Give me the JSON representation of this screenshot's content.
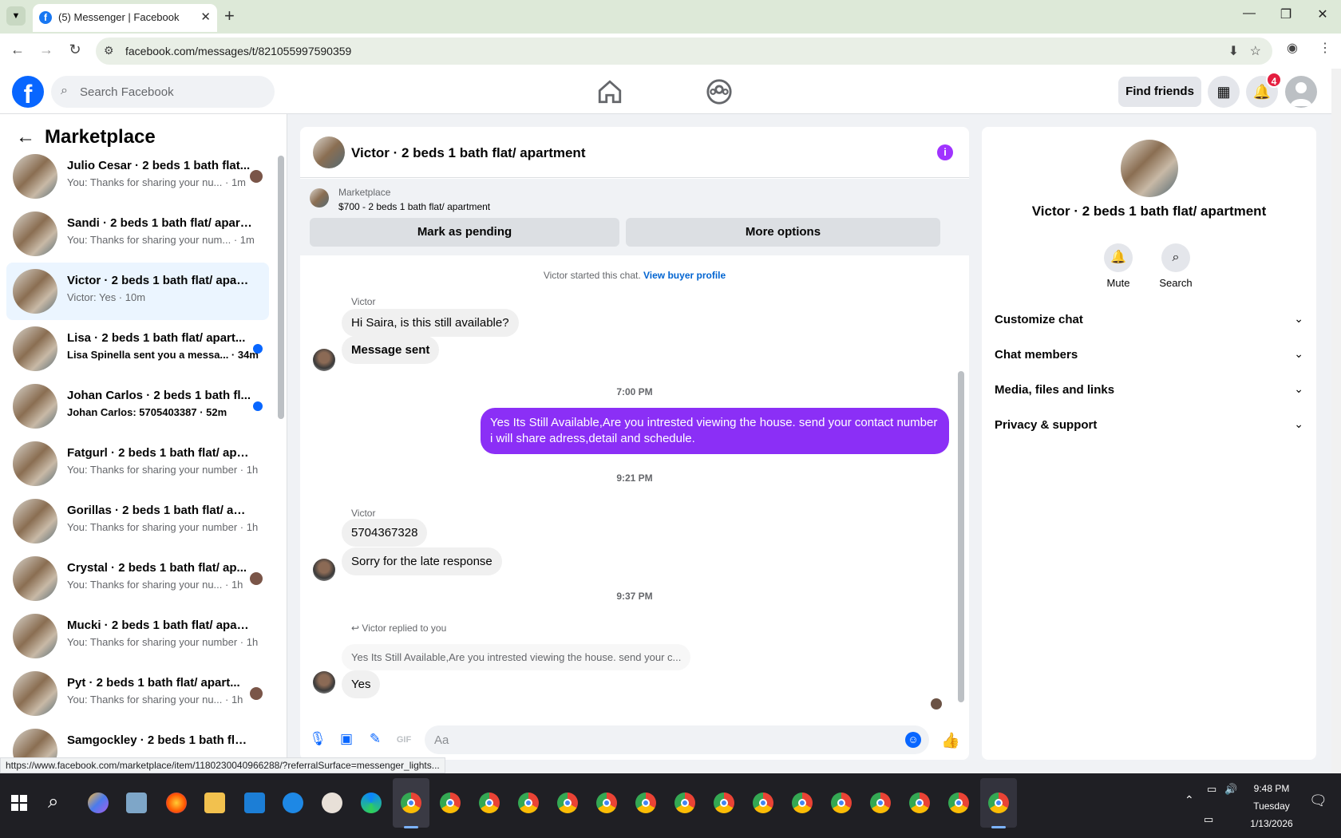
{
  "browser": {
    "tab_title": "(5) Messenger | Facebook",
    "url": "facebook.com/messages/t/821055997590359",
    "status_url": "https://www.facebook.com/marketplace/item/1180230040966288/?referralSurface=messenger_lights..."
  },
  "fb_header": {
    "search_placeholder": "Search Facebook",
    "find_friends": "Find friends",
    "notification_count": "4"
  },
  "left_panel": {
    "title": "Marketplace",
    "conversations": [
      {
        "name": "Julio Cesar · 2 beds 1 bath flat...",
        "snippet": "You: Thanks for sharing your nu... · 1m",
        "unread": false,
        "indicator": "seen-avatar"
      },
      {
        "name": "Sandi · 2 beds 1 bath flat/ apart...",
        "snippet": "You: Thanks for sharing your num... · 1m",
        "unread": false,
        "indicator": "none"
      },
      {
        "name": "Victor · 2 beds 1 bath flat/ apart...",
        "snippet": "Victor: Yes · 10m",
        "unread": false,
        "indicator": "none",
        "active": true
      },
      {
        "name": "Lisa · 2 beds 1 bath flat/ apart...",
        "snippet": "Lisa Spinella sent you a messa... · 34m",
        "unread": true,
        "indicator": "dot"
      },
      {
        "name": "Johan Carlos · 2 beds 1 bath fl...",
        "snippet": "Johan Carlos: 5705403387 · 52m",
        "unread": true,
        "indicator": "dot"
      },
      {
        "name": "Fatgurl · 2 beds 1 bath flat/ apar...",
        "snippet": "You: Thanks for sharing your number · 1h",
        "unread": false,
        "indicator": "none"
      },
      {
        "name": "Gorillas · 2 beds 1 bath flat/ apar...",
        "snippet": "You: Thanks for sharing your number · 1h",
        "unread": false,
        "indicator": "none"
      },
      {
        "name": "Crystal · 2 beds 1 bath flat/ ap...",
        "snippet": "You: Thanks for sharing your nu... · 1h",
        "unread": false,
        "indicator": "seen-avatar"
      },
      {
        "name": "Mucki · 2 beds 1 bath flat/ apart...",
        "snippet": "You: Thanks for sharing your number · 1h",
        "unread": false,
        "indicator": "none"
      },
      {
        "name": "Pyt · 2 beds 1 bath flat/ apart...",
        "snippet": "You: Thanks for sharing your nu... · 1h",
        "unread": false,
        "indicator": "seen-avatar"
      },
      {
        "name": "Samgockley · 2 beds 1 bath flat/ ...",
        "snippet": "",
        "unread": false,
        "indicator": "none"
      }
    ]
  },
  "chat": {
    "title": "Victor · 2 beds 1 bath flat/ apartment",
    "listing_label": "Marketplace",
    "listing_price": "$700 - 2 beds 1 bath flat/ apartment",
    "mark_pending": "Mark as pending",
    "more_options": "More options",
    "started_text": "Victor started this chat.",
    "view_profile": "View buyer profile",
    "sender_1": "Victor",
    "msg_1": "Hi Saira, is this still available?",
    "msg_2": "Message sent",
    "time_1": "7:00 PM",
    "my_msg": "Yes Its Still Available,Are you intrested viewing the house. send your contact number i will share adress,detail and schedule.",
    "time_2": "9:21 PM",
    "sender_2": "Victor",
    "msg_3": "5704367328",
    "msg_4": "Sorry for the late response",
    "time_3": "9:37 PM",
    "reply_label": "Victor replied to you",
    "quoted": "Yes Its Still Available,Are you intrested viewing the house. send your c...",
    "msg_5": "Yes",
    "composer_placeholder": "Aa"
  },
  "right_panel": {
    "name": "Victor · 2 beds 1 bath flat/ apartment",
    "mute": "Mute",
    "search": "Search",
    "sections": [
      "Customize chat",
      "Chat members",
      "Media, files and links",
      "Privacy & support"
    ]
  },
  "taskbar": {
    "time": "9:48 PM",
    "day": "Tuesday",
    "date": "1/13/2026"
  },
  "colors": {
    "fb_blue": "#0866ff",
    "my_bubble": "#8b2ff6",
    "unread_dot": "#0866ff",
    "badge": "#e41e3f"
  }
}
